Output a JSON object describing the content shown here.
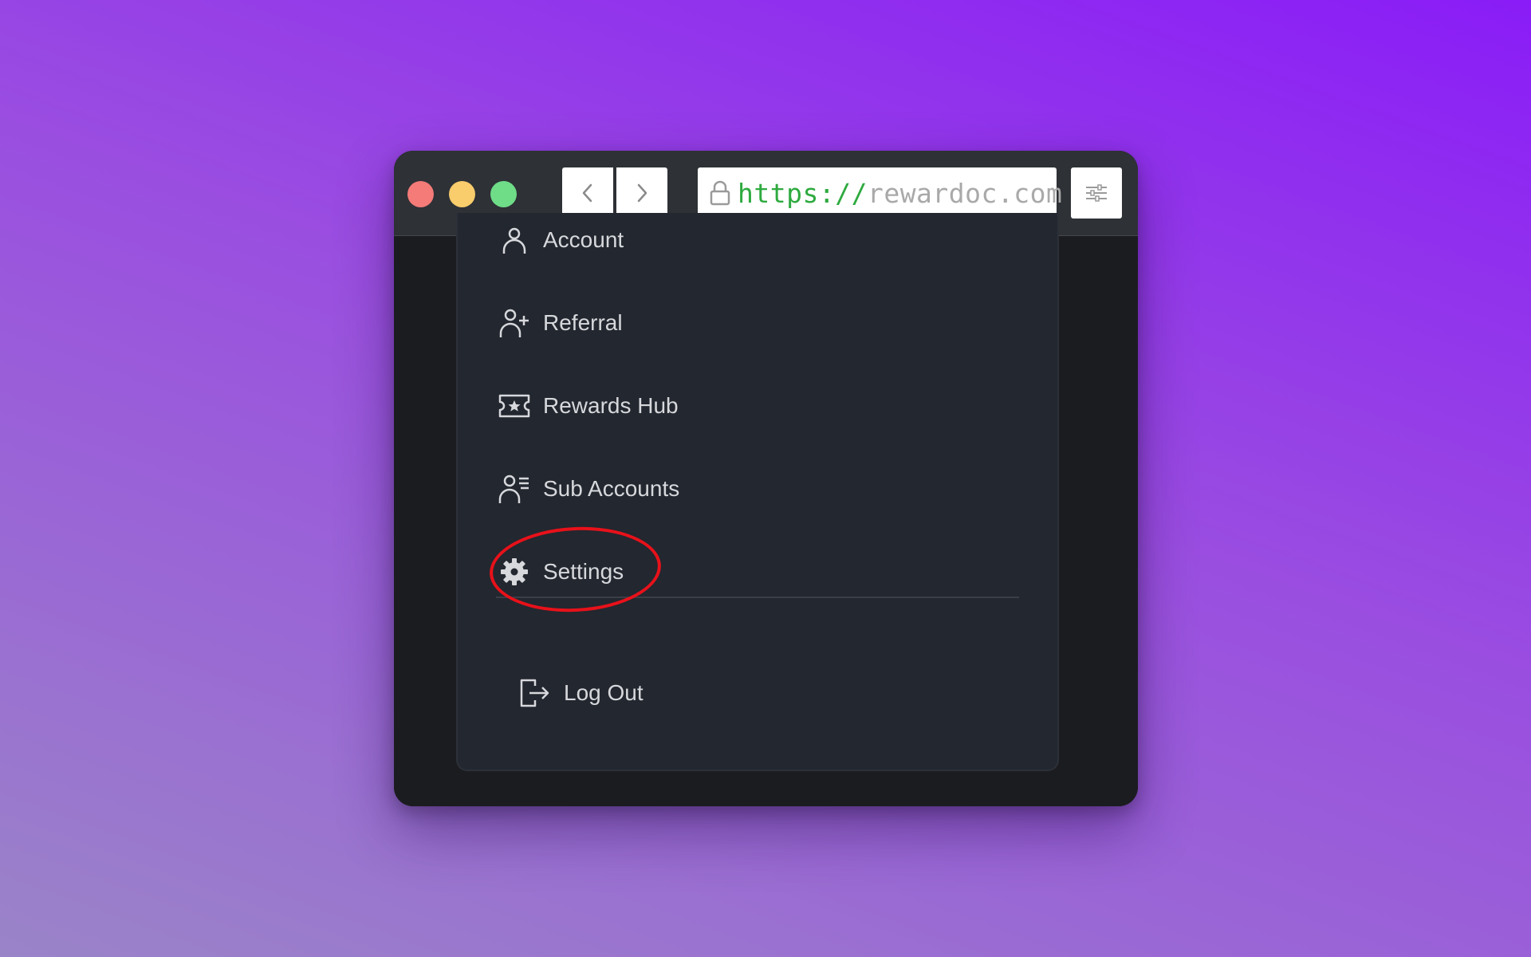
{
  "browser": {
    "url_scheme": "https://",
    "url_host": "rewardoc.com"
  },
  "menu": {
    "items": [
      {
        "label": "Account",
        "icon": "person-icon"
      },
      {
        "label": "Referral",
        "icon": "person-plus-icon"
      },
      {
        "label": "Rewards Hub",
        "icon": "ticket-star-icon"
      },
      {
        "label": "Sub Accounts",
        "icon": "person-list-icon"
      },
      {
        "label": "Settings",
        "icon": "gear-icon"
      }
    ],
    "logout_label": "Log Out"
  },
  "annotation": {
    "highlighted_item": "Settings",
    "color": "#e8111a"
  },
  "colors": {
    "background_top": "#8a1cf7",
    "background_bottom": "#9a84c8",
    "titlebar": "#2e3136",
    "panel": "#23272f",
    "text": "#d6d8dc"
  }
}
